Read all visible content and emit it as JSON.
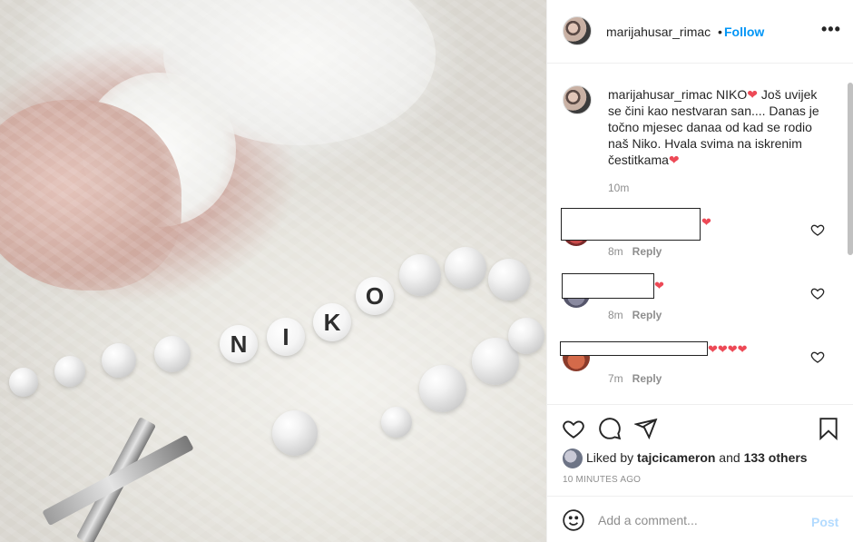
{
  "photo": {
    "bead_letters": [
      "N",
      "I",
      "K",
      "O"
    ]
  },
  "header": {
    "username": "marijahusar_rimac",
    "separator": "•",
    "follow_label": "Follow",
    "more_label": "•••"
  },
  "caption": {
    "username": "marijahusar_rimac",
    "text_part1": "NIKO",
    "text_part2": " Još uvijek se čini kao nestvaran san.... Danas je točno mjesec danaa od kad se rodio naš Niko. Hvala svima na iskrenim čestitkama",
    "heart": "❤",
    "time": "10m"
  },
  "comments": [
    {
      "hearts": "❤",
      "time": "8m",
      "reply_label": "Reply"
    },
    {
      "hearts": "❤",
      "time": "8m",
      "reply_label": "Reply"
    },
    {
      "hearts": "❤❤❤❤",
      "time": "7m",
      "reply_label": "Reply"
    }
  ],
  "likes": {
    "prefix": "Liked by ",
    "user": "tajcicameron",
    "middle": " and ",
    "others": "133 others"
  },
  "timestamp": "10 MINUTES AGO",
  "add_comment": {
    "placeholder": "Add a comment...",
    "post_label": "Post"
  },
  "colors": {
    "link_blue": "#0095f6",
    "post_disabled": "#b3dbff",
    "heart_red": "#ed4956",
    "meta_gray": "#8e8e8e"
  }
}
